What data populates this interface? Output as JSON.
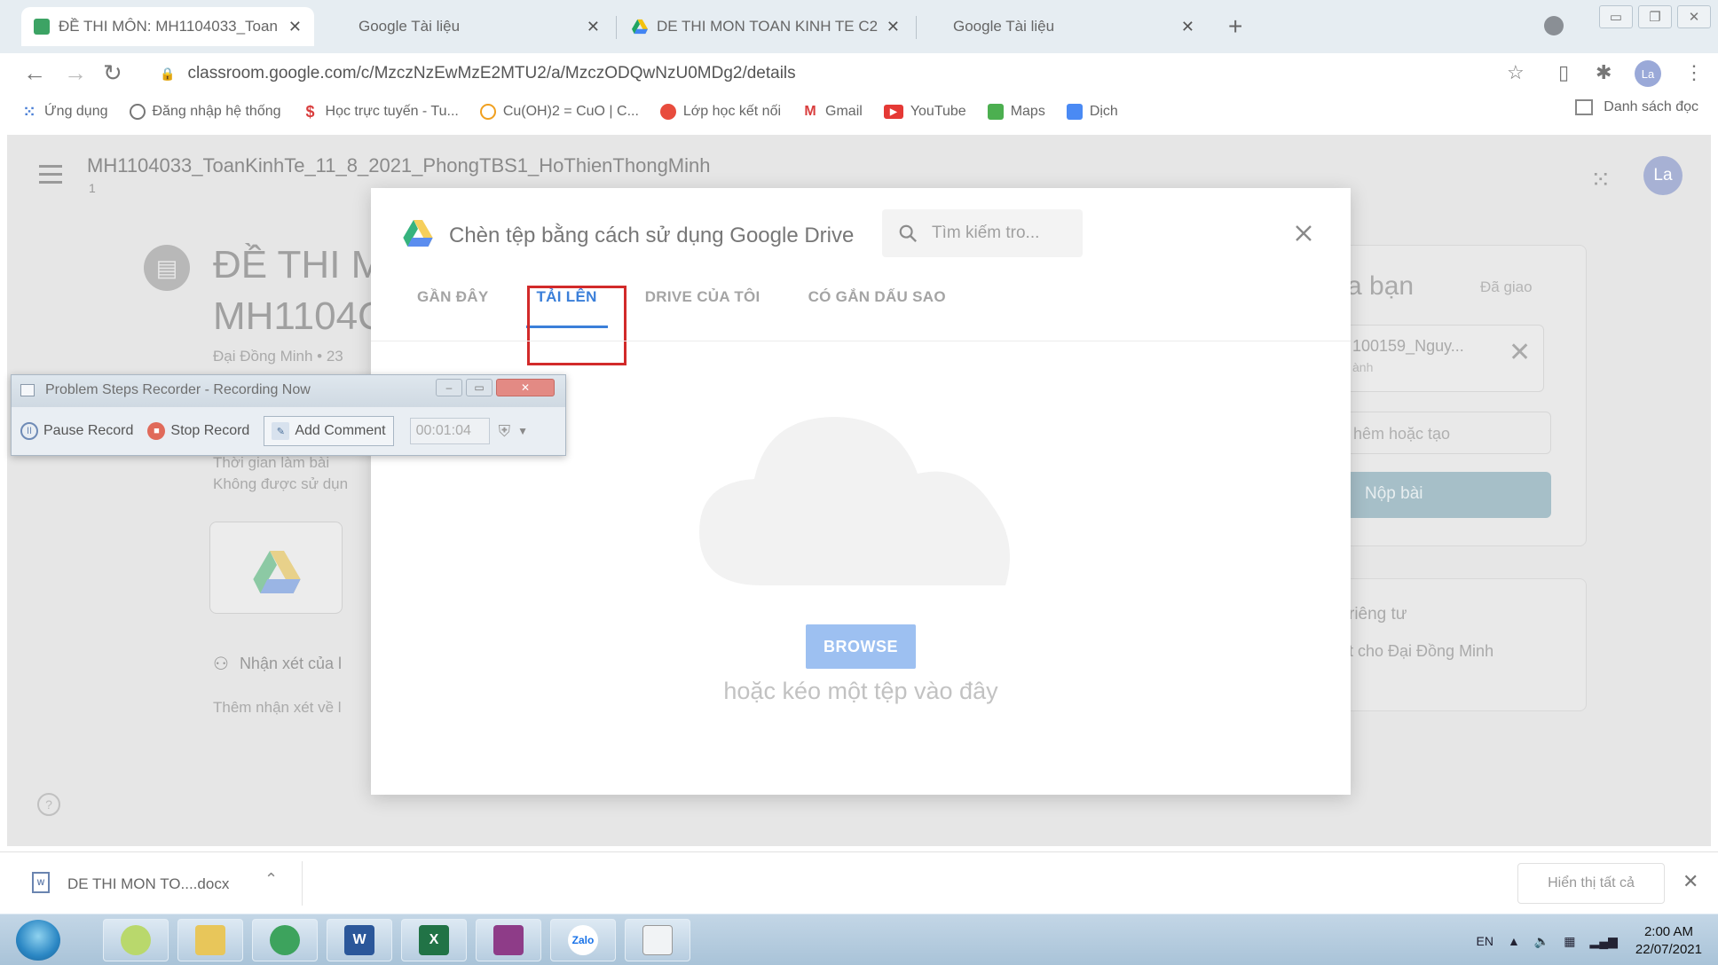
{
  "browser": {
    "tabs": [
      {
        "title": "ĐỀ THI MÔN: MH1104033_Toan",
        "active": true
      },
      {
        "title": "Google Tài liệu",
        "active": false
      },
      {
        "title": "DE THI MON TOAN KINH TE C2",
        "active": false
      },
      {
        "title": "Google Tài liệu",
        "active": false
      }
    ],
    "url": "classroom.google.com/c/MzczNzEwMzE2MTU2/a/MzczODQwNzU0MDg2/details",
    "profile_initials": "La",
    "bookmarks": [
      {
        "label": "Ứng dụng",
        "icon": "apps-grid-icon"
      },
      {
        "label": "Đăng nhập hệ thống",
        "icon": "globe-icon"
      },
      {
        "label": "Học trực tuyến - Tu...",
        "icon": "dollar-icon"
      },
      {
        "label": "Cu(OH)2 = CuO | C...",
        "icon": "loading-icon"
      },
      {
        "label": "Lớp học kết nối",
        "icon": "class-icon"
      },
      {
        "label": "Gmail",
        "icon": "gmail-icon"
      },
      {
        "label": "YouTube",
        "icon": "youtube-icon"
      },
      {
        "label": "Maps",
        "icon": "maps-icon"
      },
      {
        "label": "Dịch",
        "icon": "translate-icon"
      }
    ],
    "reading_list": "Danh sách đọc"
  },
  "classroom": {
    "course_title": "MH1104033_ToanKinhTe_11_8_2021_PhongTBS1_HoThienThongMinh",
    "course_section": "1",
    "avatar_initials": "La",
    "assignment_title_line1": "ĐỀ THI M",
    "assignment_title_line2": "MH1104C",
    "assignment_meta": "Đại Đồng Minh • 23",
    "desc_line1": "Thời gian làm bài",
    "desc_line2": "Không được sử dụn",
    "comments_label": "Nhận xét của l",
    "comments_add": "Thêm nhận xét về l",
    "your_work_title": "a bạn",
    "your_work_status": "Đã giao",
    "file_name": "100159_Nguy...",
    "file_type": "ành",
    "add_or_create": "hêm hoặc tạo",
    "submit": "Nộp bài",
    "private_title": "riêng tư",
    "private_add": "t cho Đại Đồng Minh"
  },
  "picker": {
    "title": "Chèn tệp bằng cách sử dụng Google Drive",
    "search_placeholder": "Tìm kiếm tro...",
    "tabs": [
      "GẦN ĐÂY",
      "TẢI LÊN",
      "DRIVE CỦA TÔI",
      "CÓ GẮN DẤU SAO"
    ],
    "active_tab": "TẢI LÊN",
    "browse": "BROWSE",
    "drag_hint": "hoặc kéo một tệp vào đây"
  },
  "psr": {
    "title": "Problem Steps Recorder - Recording Now",
    "pause": "Pause Record",
    "stop": "Stop Record",
    "comment": "Add Comment",
    "elapsed": "00:01:04"
  },
  "download": {
    "file": "DE THI MON TO....docx",
    "show_all": "Hiển thị tất cả"
  },
  "taskbar": {
    "apps": [
      "chrome-alt-icon",
      "explorer-icon",
      "coccoc-icon",
      "word-icon",
      "excel-icon",
      "winrar-icon",
      "zalo-icon",
      "psr-icon"
    ],
    "zalo_label": "Zalo",
    "lang": "EN",
    "time": "2:00 AM",
    "date": "22/07/2021"
  },
  "colors": {
    "accent_blue": "#3b7fd9",
    "browse_button": "#9dc0f1",
    "highlight_red": "#d22a2a",
    "submit_button": "#a6bfc8"
  }
}
